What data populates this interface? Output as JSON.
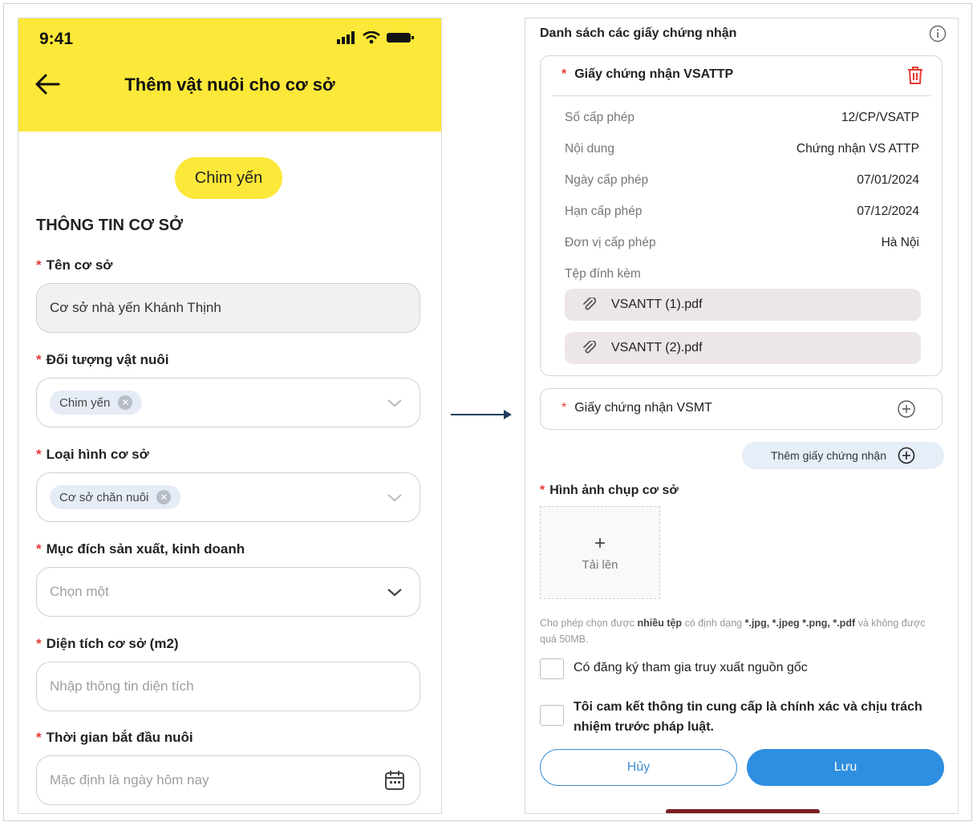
{
  "left": {
    "status_time": "9:41",
    "title": "Thêm vật nuôi cho cơ sở",
    "species_pill": "Chim yến",
    "section_title": "THÔNG TIN CƠ SỞ",
    "fields": {
      "name": {
        "label": "Tên cơ sở",
        "value": "Cơ sở nhà yến Khánh Thịnh"
      },
      "animal": {
        "label": "Đối tượng vật nuôi",
        "chip": "Chim yến"
      },
      "type": {
        "label": "Loại hình cơ sở",
        "chip": "Cơ sở chăn nuôi"
      },
      "purpose": {
        "label": "Mục đích sản xuất, kinh doanh",
        "placeholder": "Chọn một"
      },
      "area": {
        "label": "Diện tích cơ sở (m2)",
        "placeholder": "Nhập thông tin diện tích"
      },
      "start": {
        "label": "Thời gian bắt đầu nuôi",
        "placeholder": "Mặc định là ngày hôm nay"
      }
    }
  },
  "right": {
    "heading": "Danh sách các giấy chứng nhận",
    "cert1": {
      "title": "Giấy chứng nhận VSATTP",
      "rows": [
        {
          "k": "Số cấp phép",
          "v": "12/CP/VSATP"
        },
        {
          "k": "Nội dung",
          "v": "Chứng nhận VS ATTP"
        },
        {
          "k": "Ngày cấp phép",
          "v": "07/01/2024"
        },
        {
          "k": "Hạn cấp phép",
          "v": "07/12/2024"
        },
        {
          "k": "Đơn vị cấp phép",
          "v": "Hà Nội"
        }
      ],
      "attach_label": "Tệp đính kèm",
      "files": [
        "VSANTT (1).pdf",
        "VSANTT (2).pdf"
      ]
    },
    "cert2": {
      "title": "Giấy chứng nhận VSMT"
    },
    "add_cert": "Thêm giấy chứng nhận",
    "image_label": "Hình ảnh chụp cơ sở",
    "upload_label": "Tải lên",
    "note": {
      "p1": "Cho phép chọn được ",
      "b1": "nhiều tệp",
      "p2": " có định dạng ",
      "b2": "*.jpg, *.jpeg *.png, *.pdf",
      "p3": " và không được quá 50MB."
    },
    "check1": "Có đăng ký tham gia truy xuất nguồn gốc",
    "check2": "Tôi cam kết thông tin cung cấp là chính xác và chịu trách nhiệm trước pháp luật.",
    "cancel": "Hủy",
    "save": "Lưu"
  },
  "colors": {
    "yellow": "#fce838",
    "primary": "#2e8ee0",
    "required": "#e53935"
  }
}
